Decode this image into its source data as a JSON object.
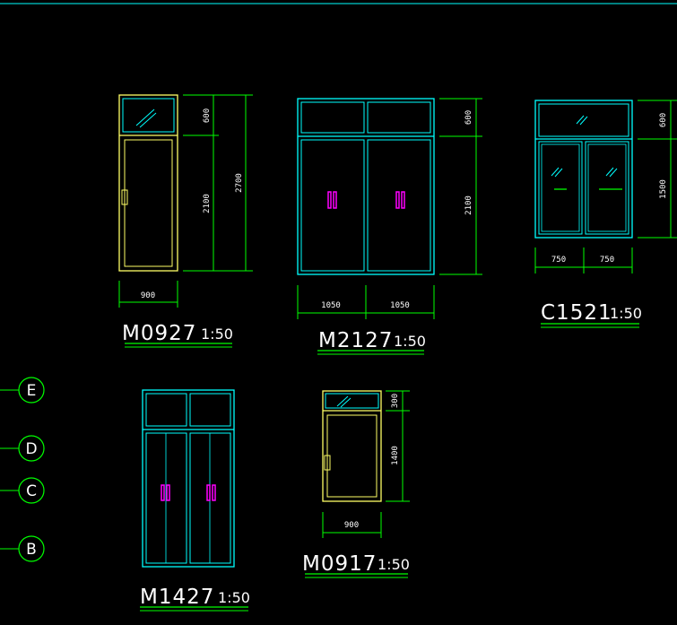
{
  "colors": {
    "background": "#000000",
    "frame_yellow": "#ffff66",
    "frame_cyan": "#00ffff",
    "dimension_green": "#00ff00",
    "handle_magenta": "#ff00ff",
    "text_white": "#ffffff"
  },
  "drawings": {
    "m0927": {
      "code": "M0927",
      "scale": "1:50",
      "dim_width": "900",
      "dim_top": "600",
      "dim_bottom": "2100",
      "dim_total": "2700"
    },
    "m2127": {
      "code": "M2127",
      "scale": "1:50",
      "dim_left_width": "1050",
      "dim_right_width": "1050",
      "dim_top": "600",
      "dim_bottom": "2100"
    },
    "c1521": {
      "code": "C1521",
      "scale": "1:50",
      "dim_left_width": "750",
      "dim_right_width": "750",
      "dim_top": "600",
      "dim_bottom": "1500"
    },
    "m1427": {
      "code": "M1427",
      "scale": "1:50"
    },
    "m0917": {
      "code": "M0917",
      "scale": "1:50",
      "dim_width": "900",
      "dim_top": "300",
      "dim_bottom": "1400"
    }
  },
  "grid_axes": [
    "E",
    "D",
    "C",
    "B"
  ]
}
